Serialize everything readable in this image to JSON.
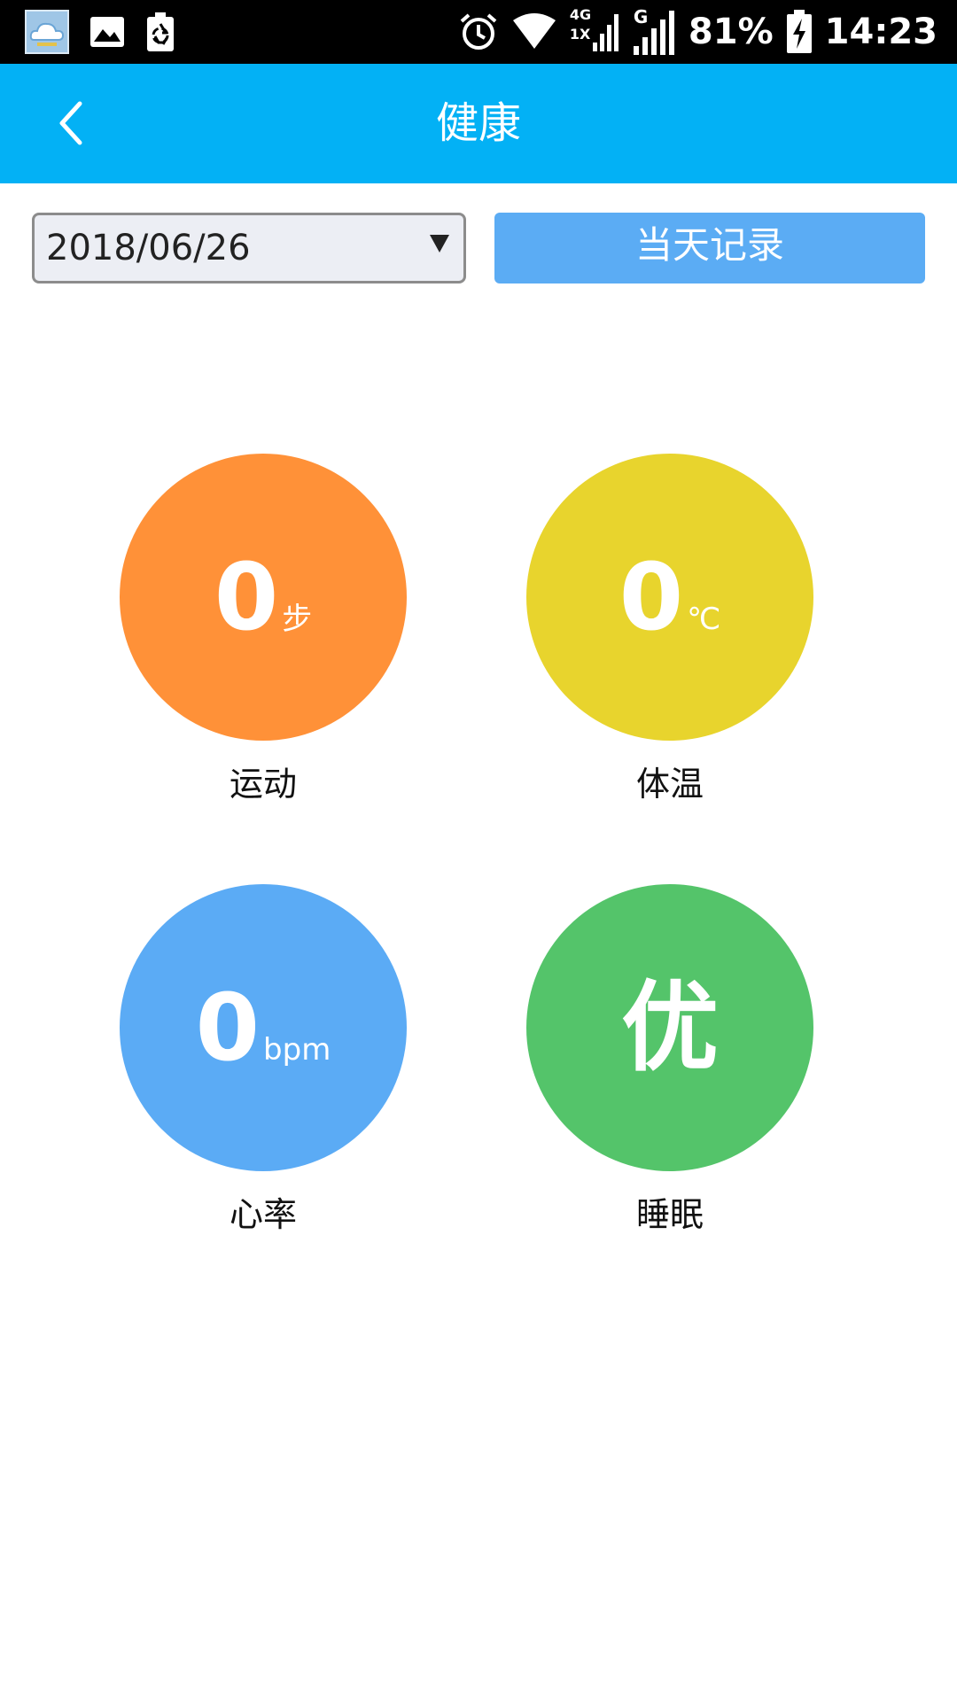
{
  "status_bar": {
    "battery": "81%",
    "time": "14:23",
    "network_label": "4G",
    "network_sub": "1X",
    "signal_label": "G",
    "icons": [
      "cloud-app-icon",
      "image-icon",
      "recycle-icon",
      "alarm-icon",
      "wifi-icon",
      "signal-icon",
      "battery-charging-icon"
    ]
  },
  "header": {
    "title": "健康",
    "back_icon": "chevron-left-icon"
  },
  "controls": {
    "date_value": "2018/06/26",
    "today_button_label": "当天记录"
  },
  "metrics": [
    {
      "value": "0",
      "unit": "步",
      "label": "运动",
      "color": "#ff9138"
    },
    {
      "value": "0",
      "unit": "℃",
      "label": "体温",
      "color": "#e8d42d"
    },
    {
      "value": "0",
      "unit": "bpm",
      "label": "心率",
      "color": "#5babf5"
    },
    {
      "value": "优",
      "unit": "",
      "label": "睡眠",
      "color": "#54c46a"
    }
  ]
}
